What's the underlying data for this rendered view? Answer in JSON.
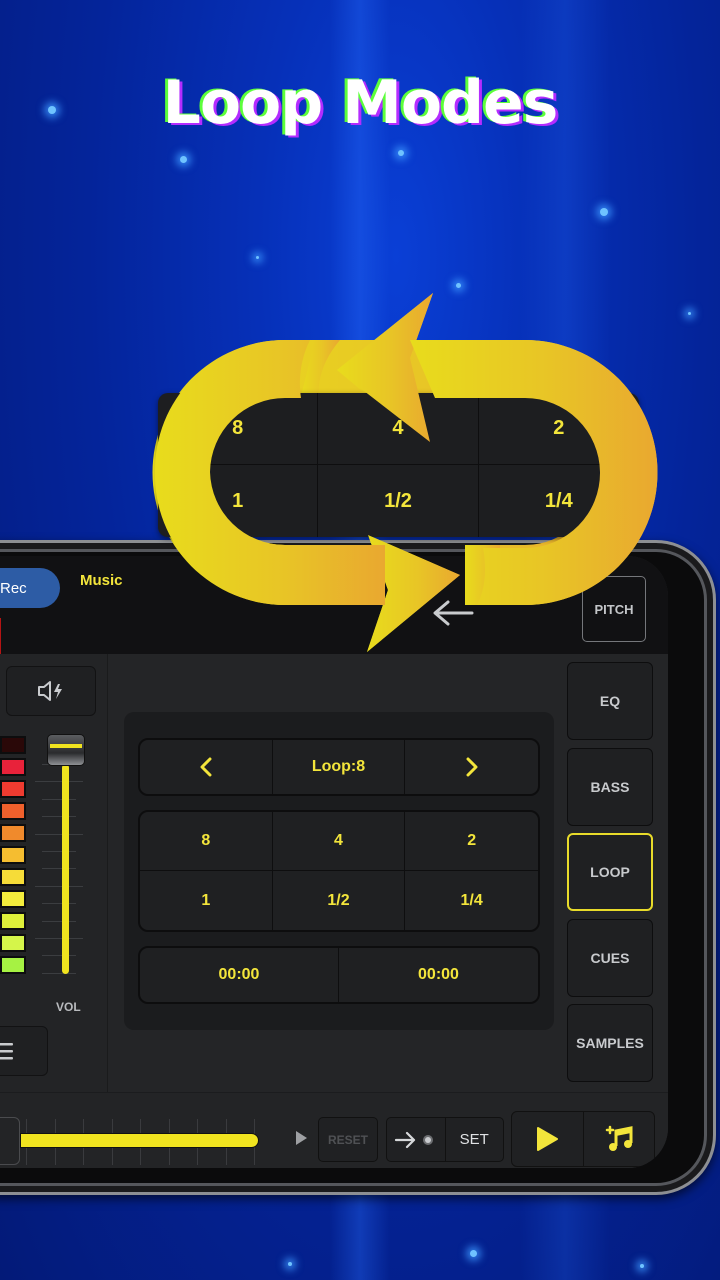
{
  "headline": "Loop Modes",
  "colors": {
    "accent_yellow": "#f3e53b",
    "arrow_gradient_start": "#e8dc1c",
    "arrow_gradient_end": "#e9a830",
    "rec_pill": "#2d5ca5",
    "active_border": "#e8db2a",
    "background_blue": "#0630b8"
  },
  "floating_loop_grid": {
    "cells": [
      "8",
      "4",
      "2",
      "1",
      "1/2",
      "1/4"
    ]
  },
  "app": {
    "top_bar": {
      "rec_label": "Rec",
      "music_tab": "Music",
      "back_icon": "arrow-left-icon",
      "pitch_label": "PITCH"
    },
    "left_panel": {
      "mute_icon": "speaker-bolt-icon",
      "level_meter_segments": [
        "#2a0808",
        "#e8223a",
        "#ef3b30",
        "#f0602c",
        "#f08a2c",
        "#f5bd30",
        "#f6dc38",
        "#f3ec3c",
        "#dff03a",
        "#d5f54a",
        "#a6f243"
      ],
      "volume_label": "VOL",
      "volume_level": 1.0,
      "menu_icon": "hamburger-menu-icon"
    },
    "loop_panel": {
      "prev_icon": "chevron-left-icon",
      "loop_display": "Loop:8",
      "next_icon": "chevron-right-icon",
      "sizes": [
        "8",
        "4",
        "2",
        "1",
        "1/2",
        "1/4"
      ],
      "loop_in": "00:00",
      "loop_out": "00:00"
    },
    "side_menu": [
      {
        "label": "EQ",
        "active": false
      },
      {
        "label": "BASS",
        "active": false
      },
      {
        "label": "LOOP",
        "active": true
      },
      {
        "label": "CUES",
        "active": false
      },
      {
        "label": "SAMPLES",
        "active": false
      }
    ],
    "bottom_bar": {
      "playback_progress": 0.9,
      "reset_label": "RESET",
      "cue_icon": "arrow-right-dot-icon",
      "set_label": "SET",
      "play_icon": "play-icon",
      "add_music_icon": "add-music-note-icon"
    }
  }
}
